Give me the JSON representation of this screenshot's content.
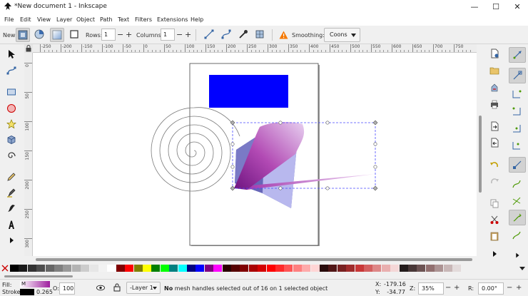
{
  "window": {
    "title": "*New document 1 - Inkscape"
  },
  "menu": [
    "File",
    "Edit",
    "View",
    "Layer",
    "Object",
    "Path",
    "Text",
    "Filters",
    "Extensions",
    "Help"
  ],
  "controls": {
    "new_label": "New:",
    "rows_label": "Rows:",
    "rows_value": "1",
    "columns_label": "Columns:",
    "columns_value": "1",
    "smoothing_label": "Smoothing:",
    "smoothing_value": "Coons"
  },
  "hruler_ticks": [
    "-250",
    "-200",
    "-150",
    "-100",
    "-50",
    "0",
    "50",
    "100",
    "150",
    "200",
    "250",
    "300",
    "350",
    "400",
    "450",
    "500",
    "550",
    "600",
    "650",
    "700",
    "750"
  ],
  "vruler_ticks": [
    "0",
    "50",
    "100",
    "150",
    "200",
    "250",
    "300"
  ],
  "palette": {
    "colors": [
      "#000000",
      "#1a1a1a",
      "#333333",
      "#4d4d4d",
      "#666666",
      "#808080",
      "#999999",
      "#b3b3b3",
      "#cccccc",
      "#e6e6e6",
      "#f2f2f2",
      "#ffffff",
      "#800000",
      "#ff0000",
      "#808000",
      "#ffff00",
      "#008000",
      "#00ff00",
      "#008080",
      "#00ffff",
      "#000080",
      "#0000ff",
      "#800080",
      "#ff00ff",
      "#2b0000",
      "#550000",
      "#800000",
      "#aa0000",
      "#d40000",
      "#ff0000",
      "#ff2a2a",
      "#ff5555",
      "#ff8080",
      "#ffaaaa",
      "#ffd5d5",
      "#280b0b",
      "#501616",
      "#782121",
      "#a02c2c",
      "#c83737",
      "#d35f5f",
      "#de8787",
      "#e9afaf",
      "#f4d7d7",
      "#241c1c",
      "#483737",
      "#6c5353",
      "#916f6f",
      "#ac9393",
      "#c8b7b7",
      "#e3dbdb"
    ]
  },
  "status": {
    "fill_label": "Fill:",
    "fill_value": "M",
    "stroke_label": "Stroke:",
    "stroke_width": "0.265",
    "opacity_label": "O:",
    "opacity_value": "100",
    "layer_value": "-Layer 1",
    "message_bold": "No",
    "message_rest": " mesh handles selected out of 16 on 1 selected object",
    "x_label": "X:",
    "x_value": "-179.16",
    "y_label": "Y:",
    "y_value": "-34.77",
    "zoom_label": "Z:",
    "zoom_value": "35%",
    "rotate_label": "R:",
    "rotate_value": "0.00°"
  }
}
